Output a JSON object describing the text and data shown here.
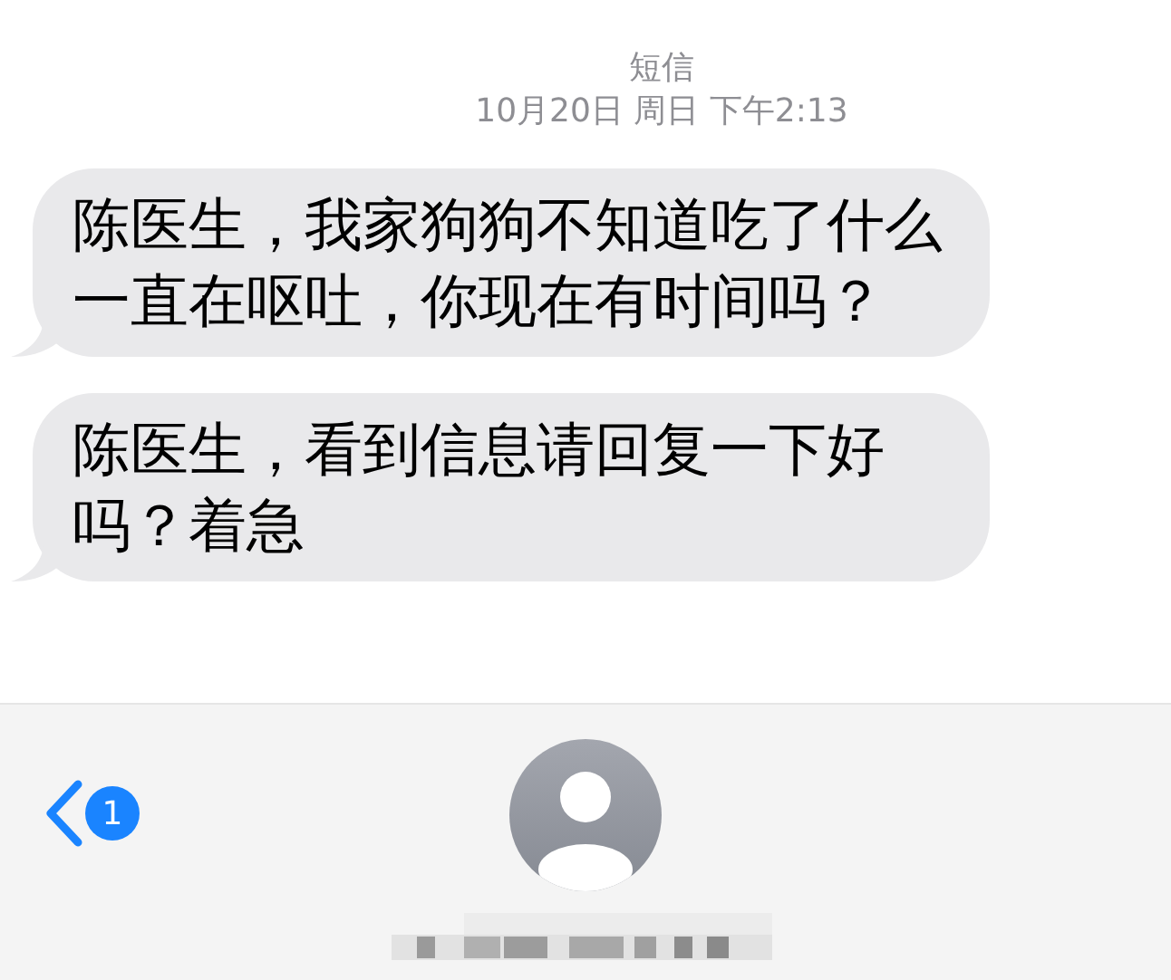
{
  "header": {
    "service": "短信",
    "timestamp": "10月20日 周日 下午2:13"
  },
  "messages": [
    {
      "text": "陈医生，我家狗狗不知道吃了什么一直在呕吐，你现在有时间吗？"
    },
    {
      "text": "陈医生，看到信息请回复一下好吗？着急"
    }
  ],
  "nav_bar": {
    "back_badge": "1"
  }
}
